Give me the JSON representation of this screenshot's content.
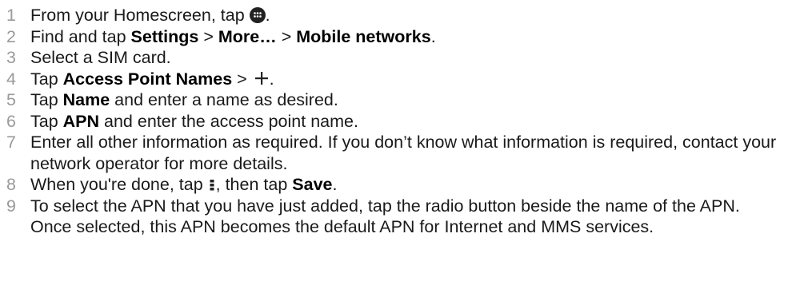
{
  "steps": [
    {
      "number": "1",
      "parts": [
        "From your Homescreen, tap ",
        "."
      ],
      "icon": "apps-icon"
    },
    {
      "number": "2",
      "parts": [
        "Find and tap ",
        "Settings",
        " > ",
        "More…",
        " > ",
        "Mobile networks",
        "."
      ]
    },
    {
      "number": "3",
      "text": "Select a SIM card."
    },
    {
      "number": "4",
      "parts": [
        "Tap ",
        "Access Point Names",
        " > ",
        "."
      ],
      "icon": "plus-icon"
    },
    {
      "number": "5",
      "parts": [
        "Tap ",
        "Name",
        " and enter a name as desired."
      ]
    },
    {
      "number": "6",
      "parts": [
        "Tap ",
        "APN",
        " and enter the access point name."
      ]
    },
    {
      "number": "7",
      "text": "Enter all other information as required. If you don’t know what information is required, contact your network operator for more details."
    },
    {
      "number": "8",
      "parts": [
        "When you're done, tap ",
        ", then tap ",
        "Save",
        "."
      ],
      "icon": "overflow-menu-icon"
    },
    {
      "number": "9",
      "text": "To select the APN that you have just added, tap the radio button beside the name of the APN. Once selected, this APN becomes the default APN for Internet and MMS services."
    }
  ]
}
